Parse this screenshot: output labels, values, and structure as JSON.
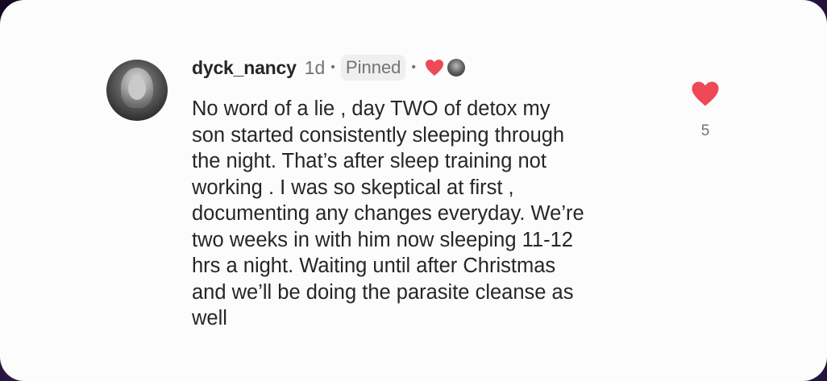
{
  "comment": {
    "username": "dyck_nancy",
    "time": "1d",
    "separator": "•",
    "pinned_label": "Pinned",
    "text_lines": [
      "No word of a lie , day TWO of detox my",
      "son started consistently sleeping through",
      "the night.  That’s after sleep training not",
      "working . I was so skeptical at first ,",
      "documenting any changes everyday. We’re",
      "two weeks in with him now sleeping 11-12",
      "hrs a night.  Waiting until after Christmas",
      "and we’ll be doing the parasite cleanse as",
      "well"
    ],
    "like_count": "5",
    "like_icon": "heart-filled-icon",
    "creator_liked_icon": "heart-icon"
  },
  "colors": {
    "heart": "#ed4956",
    "text": "#262626",
    "muted": "#737373",
    "card": "#fcfcfc"
  }
}
